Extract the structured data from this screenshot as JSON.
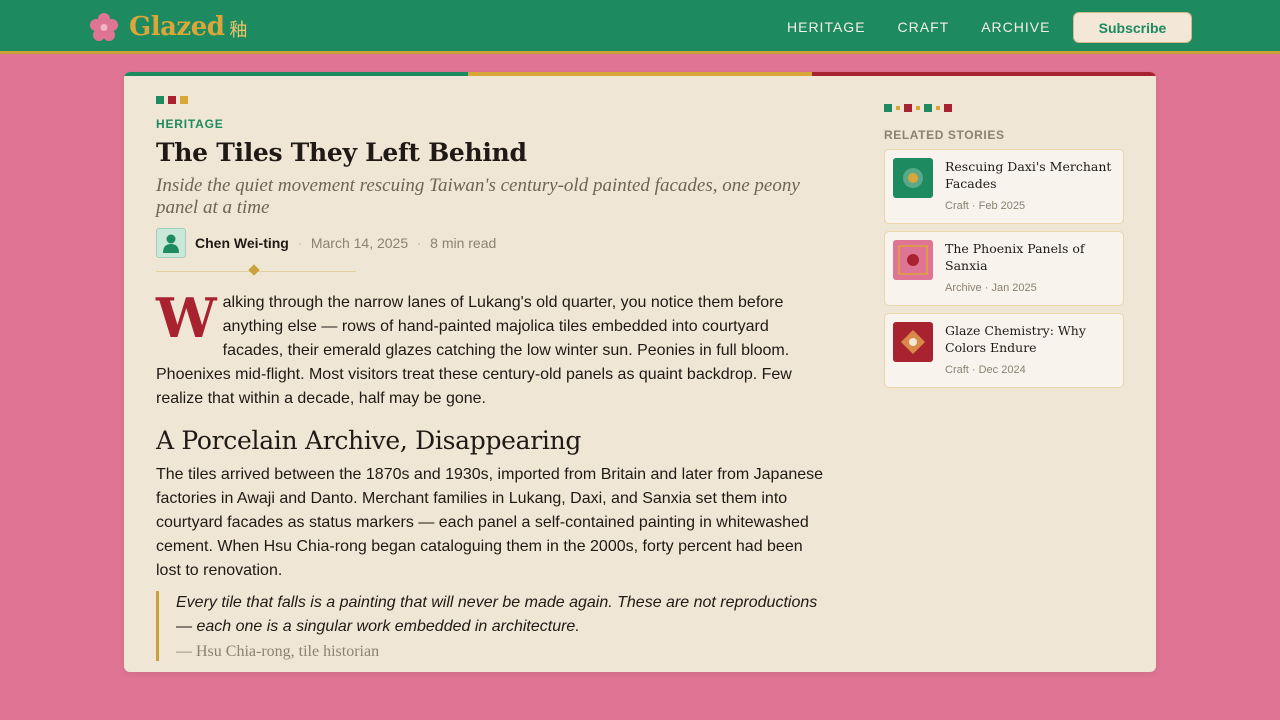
{
  "brand": {
    "name": "Glazed",
    "glyph": "釉",
    "logo_icon": "plum-blossom-icon"
  },
  "nav": {
    "items": [
      {
        "label": "HERITAGE"
      },
      {
        "label": "CRAFT"
      },
      {
        "label": "ARCHIVE"
      }
    ],
    "subscribe_label": "Subscribe"
  },
  "colors": {
    "green": "#1e8a5f",
    "gold": "#d9a63a",
    "red": "#a8232f",
    "pink": "#e07494",
    "paper": "#f0e6d5"
  },
  "article": {
    "category": "HERITAGE",
    "title": "The Tiles They Left Behind",
    "subtitle": "Inside the quiet movement rescuing Taiwan's century-old painted facades, one peony panel at a time",
    "author": "Chen Wei-ting",
    "date": "March 14, 2025",
    "read_time": "8 min read",
    "separator": "·",
    "dropcap": "W",
    "intro_rest": "alking through the narrow lanes of Lukang's old quarter, you notice them before anything else — rows of hand-painted majolica tiles embedded into courtyard facades, their emerald glazes catching the low winter sun. Peonies in full bloom. Phoenixes mid-flight. Most visitors treat these century-old panels as quaint backdrop. Few realize that within a decade, half may be gone.",
    "section_heading": "A Porcelain Archive, Disappearing",
    "section_paragraph": "The tiles arrived between the 1870s and 1930s, imported from Britain and later from Japanese factories in Awaji and Danto. Merchant families in Lukang, Daxi, and Sanxia set them into courtyard facades as status markers — each panel a self-contained painting in whitewashed cement. When Hsu Chia-rong began cataloguing them in the 2000s, forty percent had been lost to renovation.",
    "quote": "Every tile that falls is a painting that will never be made again. These are not reproductions — each one is a singular work embedded in architecture.",
    "quote_cite": "— Hsu Chia-rong, tile historian"
  },
  "sidebar": {
    "title": "RELATED STORIES",
    "stories": [
      {
        "title": "Rescuing Daxi's Merchant Facades",
        "meta": "Craft · Feb 2025",
        "thumb_icon": "green-tile-icon"
      },
      {
        "title": "The Phoenix Panels of Sanxia",
        "meta": "Archive · Jan 2025",
        "thumb_icon": "pink-tile-icon"
      },
      {
        "title": "Glaze Chemistry: Why Colors Endure",
        "meta": "Craft · Dec 2024",
        "thumb_icon": "red-tile-icon"
      }
    ]
  }
}
